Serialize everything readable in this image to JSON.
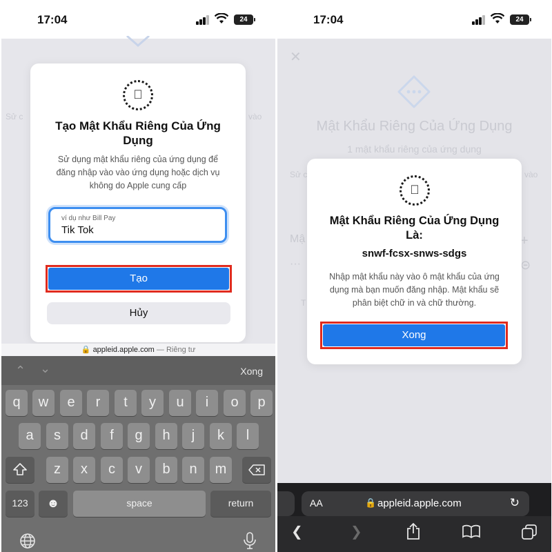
{
  "left": {
    "status": {
      "time": "17:04",
      "battery": "24"
    },
    "dialog": {
      "title": "Tạo Mật Khẩu Riêng Của Ứng Dụng",
      "body": "Sử dụng mật khẩu riêng của ứng dụng để đăng nhập vào vào ứng dụng hoặc dịch vụ không do Apple cung cấp",
      "input_placeholder": "ví dụ như Bill Pay",
      "input_value": "Tik Tok",
      "create_label": "Tạo",
      "cancel_label": "Hủy"
    },
    "ghost": {
      "left_text": "Sử c",
      "right_text": "vào"
    },
    "urlbar": {
      "domain": "appleid.apple.com",
      "suffix": "— Riêng tư"
    },
    "keyboard": {
      "done_label": "Xong",
      "row1": [
        "q",
        "w",
        "e",
        "r",
        "t",
        "y",
        "u",
        "i",
        "o",
        "p"
      ],
      "row2": [
        "a",
        "s",
        "d",
        "f",
        "g",
        "h",
        "j",
        "k",
        "l"
      ],
      "row3": [
        "z",
        "x",
        "c",
        "v",
        "b",
        "n",
        "m"
      ],
      "num_label": "123",
      "space_label": "space",
      "return_label": "return"
    }
  },
  "right": {
    "status": {
      "time": "17:04",
      "battery": "24"
    },
    "background": {
      "title": "Mật Khẩu Riêng Của Ứng Dụng",
      "subtitle": "1 mật khẩu riêng của ứng dụng",
      "left_fragment": "Sử c",
      "right_fragment": "vào",
      "row_fragment": "Mậ",
      "dots_fragment": "···",
      "t_fragment": "T"
    },
    "dialog": {
      "title": "Mật Khẩu Riêng Của Ứng Dụng Là:",
      "password": "snwf-fcsx-snws-sdgs",
      "body": "Nhập mật khẩu này vào ô mật khẩu của ứng dụng mà bạn muốn đăng nhập. Mật khẩu sẽ phân biệt chữ in và chữ thường.",
      "done_label": "Xong"
    },
    "address_bar": {
      "aa": "AA",
      "url": "appleid.apple.com"
    }
  },
  "colors": {
    "accent": "#1f78e8",
    "highlight": "#e02b1e",
    "focus": "#3d8ef0"
  },
  "icons": [
    "apple-logo-icon",
    "lock-icon",
    "globe-icon",
    "mic-icon",
    "shift-icon",
    "delete-icon",
    "emoji-icon",
    "reload-icon",
    "back-icon",
    "forward-icon",
    "share-icon",
    "bookmarks-icon",
    "tabs-icon",
    "close-icon",
    "key-dots-icon"
  ]
}
